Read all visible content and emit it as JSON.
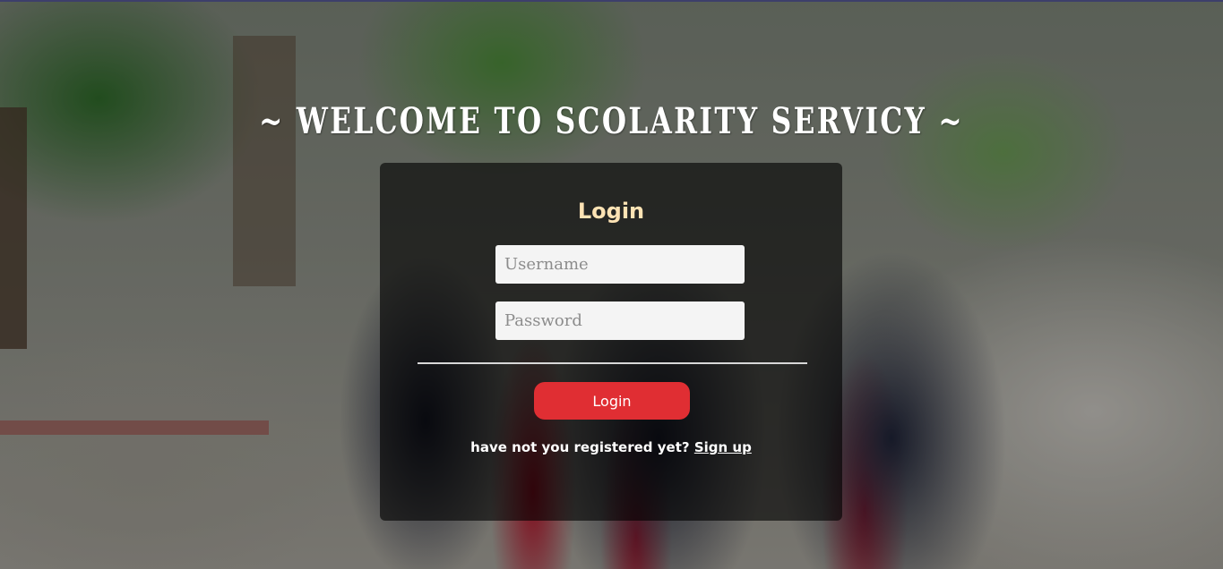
{
  "header": {
    "welcome_text": "~ Welcome to scolarity servicy ~"
  },
  "login": {
    "title": "Login",
    "username_placeholder": "Username",
    "username_value": "",
    "password_placeholder": "Password",
    "password_value": "",
    "button_label": "Login",
    "register_prompt": "have not you registered yet?",
    "signup_link": "Sign up"
  },
  "colors": {
    "title_accent": "#fde3b4",
    "login_button": "#e02e33",
    "card_overlay": "rgba(0,0,0,0.62)"
  }
}
